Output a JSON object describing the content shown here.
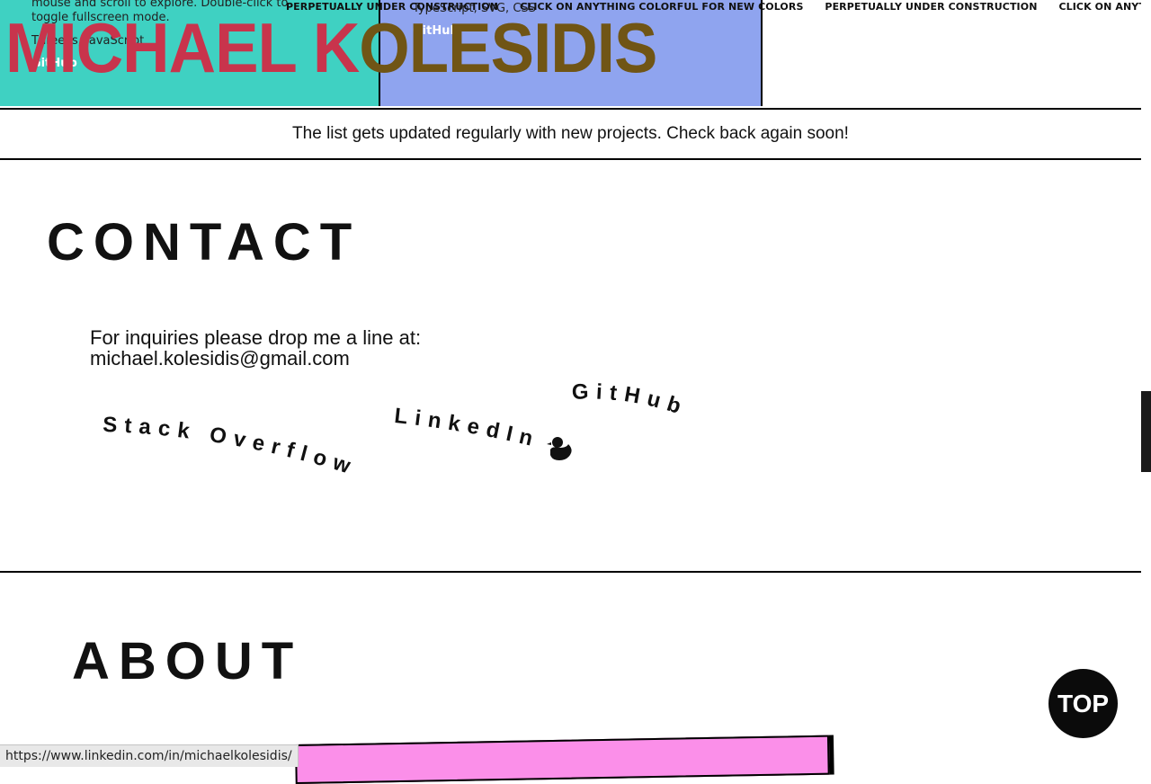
{
  "project_cards": [
    {
      "description": "mouse and scroll to explore. Double-click to toggle fullscreen mode.",
      "tech": "Three.js, JavaScript",
      "github_label": "GitHub",
      "color": "#3fd1c2"
    },
    {
      "tech": "TypeScript, SVG, CSS",
      "github_label": "GitHub",
      "color": "#8fa4ef"
    }
  ],
  "marquee": [
    "PERPETUALLY UNDER CONSTRUCTION",
    "CLICK ON ANYTHING COLORFUL FOR NEW COLORS",
    "PERPETUALLY UNDER CONSTRUCTION",
    "CLICK ON ANYTHING COLORFUL FOR NEW COLORS"
  ],
  "name": {
    "first": "MICHAEL K",
    "last": "OLESIDIS",
    "color_first": "#c8344c",
    "color_last": "#705515"
  },
  "notice": "The list gets updated regularly with new projects. Check back again soon!",
  "contact": {
    "heading": "CONTACT",
    "line1": "For inquiries please drop me a line at:",
    "email": "michael.kolesidis@gmail.com",
    "links": {
      "stackoverflow": "Stack Overflow",
      "linkedin": "LinkedIn",
      "github": "GitHub"
    }
  },
  "about": {
    "heading": "ABOUT"
  },
  "top_button": "TOP",
  "status_url": "https://www.linkedin.com/in/michaelkolesidis/",
  "icons": [
    "duck-icon"
  ]
}
